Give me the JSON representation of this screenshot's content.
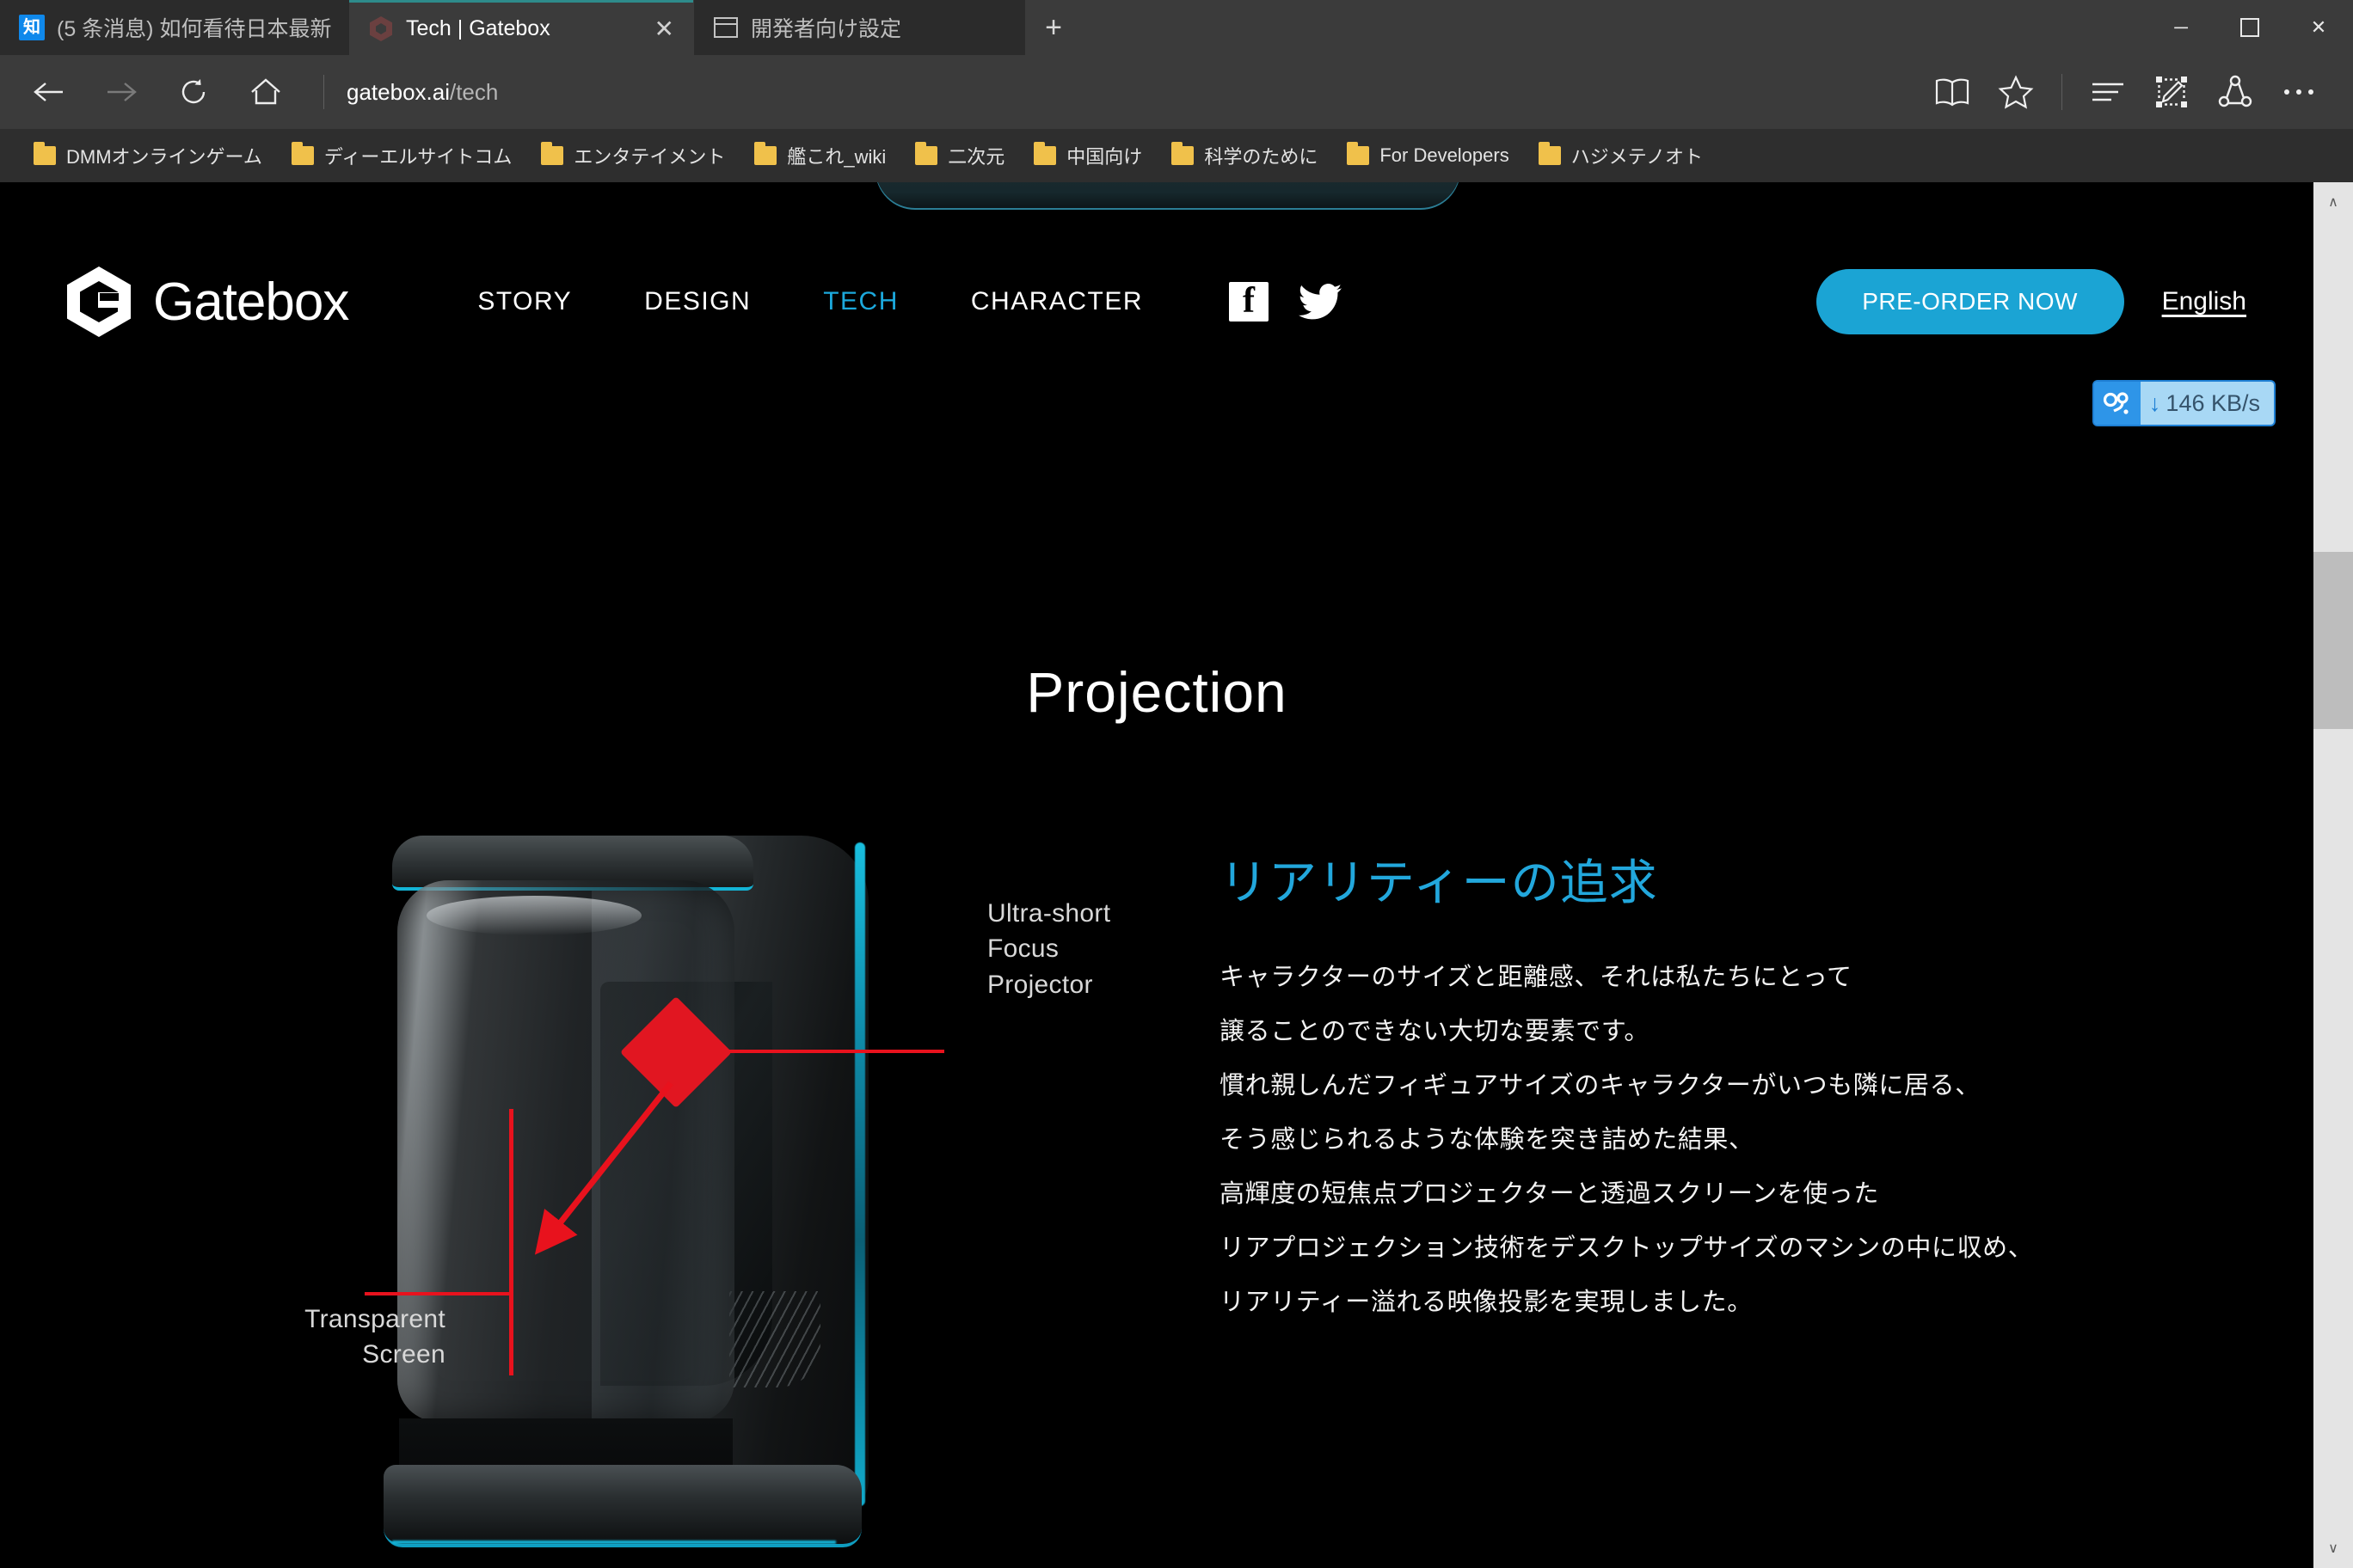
{
  "browser": {
    "tabs": [
      {
        "title": "(5 条消息) 如何看待日本最新",
        "favicon": "zhihu-icon",
        "active": false
      },
      {
        "title": "Tech | Gatebox",
        "favicon": "gatebox-icon",
        "active": true,
        "close_label": "✕"
      },
      {
        "title": "開発者向け設定",
        "favicon": "window-icon",
        "active": false
      }
    ],
    "new_tab_label": "+",
    "window_controls": {
      "minimize": "─",
      "maximize": "☐",
      "close": "✕"
    },
    "nav": {
      "back_label": "←",
      "forward_label": "→",
      "refresh_label": "⟳",
      "home_label": "⌂"
    },
    "address": {
      "host": "gatebox.ai",
      "path": "/tech"
    },
    "toolbar_icons": [
      "reading-view-icon",
      "favorites-star-icon",
      "hub-icon",
      "web-note-icon",
      "share-icon",
      "more-icon"
    ],
    "bookmarks": [
      "DMMオンラインゲーム",
      "ディーエルサイトコム",
      "エンタテイメント",
      "艦これ_wiki",
      "二次元",
      "中国向け",
      "科学のために",
      "For Developers",
      "ハジメテノオト"
    ]
  },
  "netbadge": {
    "arrow": "↓",
    "speed": "146 KB/s"
  },
  "site": {
    "brand": "Gatebox",
    "nav_items": [
      {
        "label": "STORY",
        "active": false
      },
      {
        "label": "DESIGN",
        "active": false
      },
      {
        "label": "TECH",
        "active": true
      },
      {
        "label": "CHARACTER",
        "active": false
      }
    ],
    "social": [
      "facebook-icon",
      "twitter-icon"
    ],
    "preorder_label": "PRE-ORDER NOW",
    "language_label": "English",
    "accent_color": "#1BA4D4"
  },
  "main": {
    "section_title": "Projection",
    "diagram": {
      "label_projector": [
        "Ultra-short",
        "Focus",
        "Projector"
      ],
      "label_screen": [
        "Transparent",
        "Screen"
      ],
      "annotation_color": "#E8121D",
      "device_glow_color": "#15B6DA"
    },
    "heading": "リアリティーの追求",
    "heading_color": "#22A7DC",
    "paragraph": [
      "キャラクターのサイズと距離感、それは私たちにとって",
      "譲ることのできない大切な要素です。",
      "慣れ親しんだフィギュアサイズのキャラクターがいつも隣に居る、",
      "そう感じられるような体験を突き詰めた結果、",
      "高輝度の短焦点プロジェクターと透過スクリーンを使った",
      "リアプロジェクション技術をデスクトップサイズのマシンの中に収め、",
      "リアリティー溢れる映像投影を実現しました。"
    ]
  },
  "scrollbar": {
    "up": "∧",
    "down": "∨"
  }
}
